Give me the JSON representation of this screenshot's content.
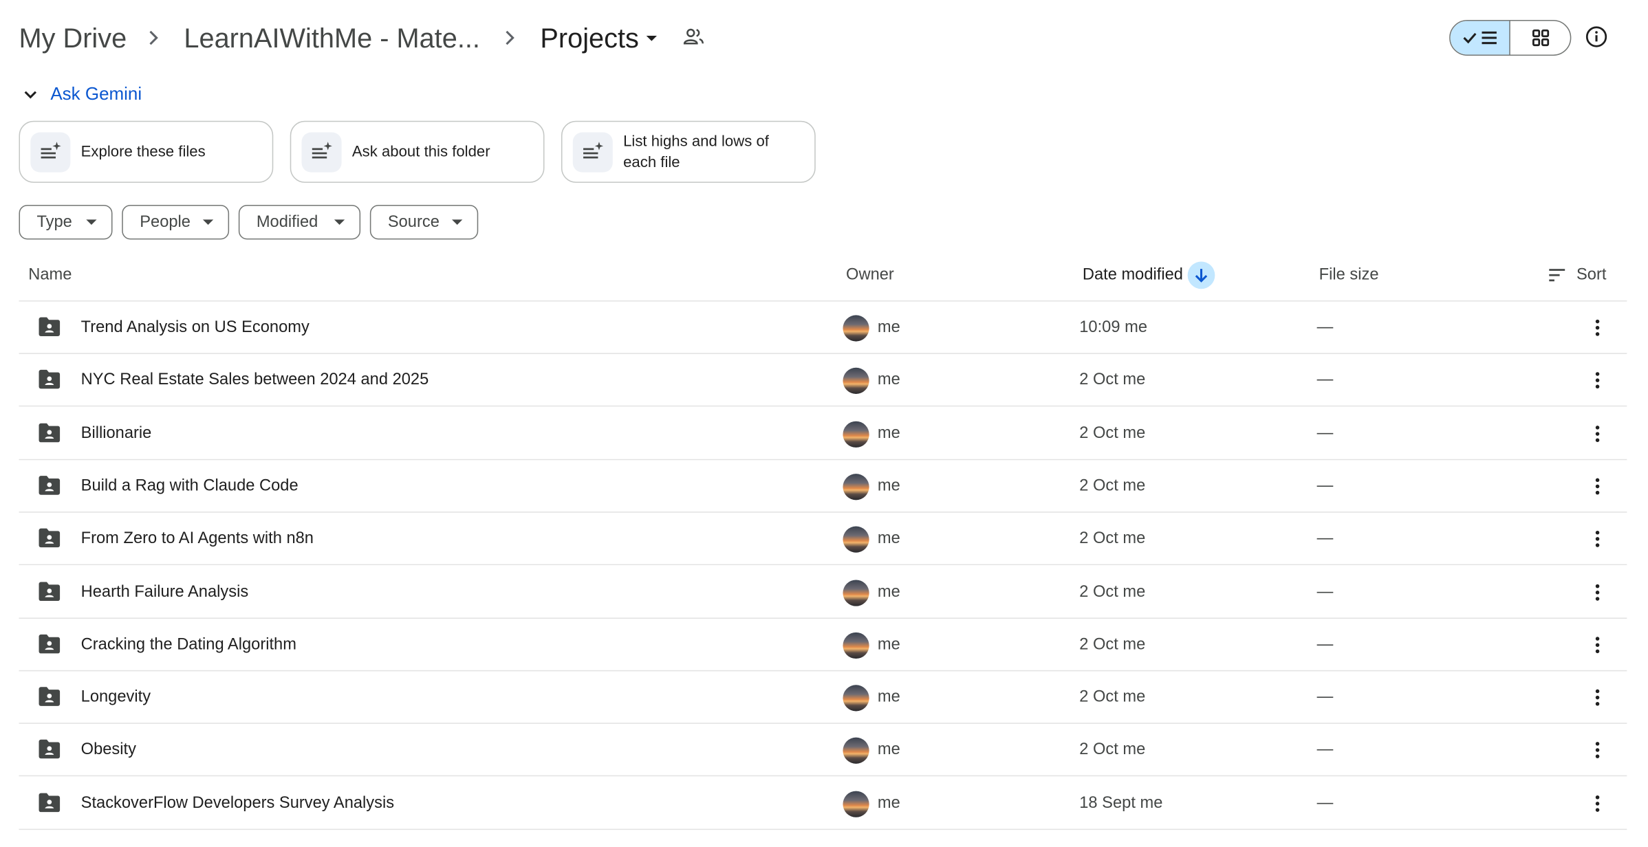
{
  "breadcrumb": {
    "root": "My Drive",
    "parent": "LearnAIWithMe - Mate...",
    "current": "Projects"
  },
  "gemini": {
    "title": "Ask Gemini",
    "suggestions": [
      {
        "label": "Explore these files"
      },
      {
        "label": "Ask about this folder"
      },
      {
        "label": "List highs and lows of each file"
      }
    ]
  },
  "filters": [
    {
      "label": "Type"
    },
    {
      "label": "People"
    },
    {
      "label": "Modified"
    },
    {
      "label": "Source"
    }
  ],
  "table": {
    "columns": {
      "name": "Name",
      "owner": "Owner",
      "date_modified": "Date modified",
      "file_size": "File size",
      "sort": "Sort"
    },
    "rows": [
      {
        "name": "Trend Analysis on US Economy",
        "owner": "me",
        "date": "10:09 me",
        "size": "—"
      },
      {
        "name": "NYC Real Estate Sales between 2024 and 2025",
        "owner": "me",
        "date": "2 Oct me",
        "size": "—"
      },
      {
        "name": "Billionarie",
        "owner": "me",
        "date": "2 Oct me",
        "size": "—"
      },
      {
        "name": "Build a Rag with Claude Code",
        "owner": "me",
        "date": "2 Oct me",
        "size": "—"
      },
      {
        "name": "From Zero to AI Agents with n8n",
        "owner": "me",
        "date": "2 Oct me",
        "size": "—"
      },
      {
        "name": "Hearth Failure Analysis",
        "owner": "me",
        "date": "2 Oct me",
        "size": "—"
      },
      {
        "name": "Cracking the Dating Algorithm",
        "owner": "me",
        "date": "2 Oct me",
        "size": "—"
      },
      {
        "name": "Longevity",
        "owner": "me",
        "date": "2 Oct me",
        "size": "—"
      },
      {
        "name": "Obesity",
        "owner": "me",
        "date": "2 Oct me",
        "size": "—"
      },
      {
        "name": "StackoverFlow Developers Survey Analysis",
        "owner": "me",
        "date": "18 Sept me",
        "size": "—"
      }
    ]
  },
  "icons": {
    "folder": "shared-folder-icon",
    "more": "more-vert-icon",
    "sort_direction": "arrow-down-icon"
  },
  "colors": {
    "accent": "#0b57d0",
    "selected_bg": "#c2e7ff",
    "divider": "#e3e3e3"
  }
}
